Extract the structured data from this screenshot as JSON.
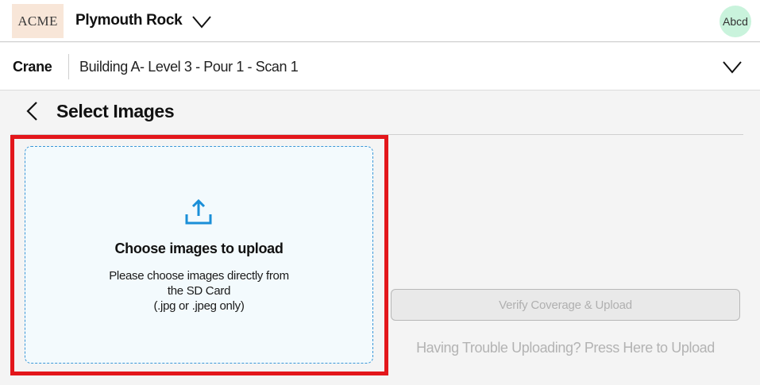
{
  "header": {
    "logo_text": "ACME",
    "project_name": "Plymouth Rock",
    "avatar_text": "Abcd"
  },
  "subheader": {
    "equipment": "Crane",
    "scan_path": "Building A- Level 3 - Pour 1 - Scan 1"
  },
  "page": {
    "title": "Select Images"
  },
  "dropzone": {
    "title": "Choose images to upload",
    "description_lines": [
      "Please choose images directly from",
      "the SD Card",
      "(.jpg or .jpeg only)"
    ]
  },
  "actions": {
    "verify_label": "Verify Coverage & Upload",
    "help_link": "Having Trouble Uploading? Press Here to Upload"
  },
  "icons": {
    "project_chevron": "chevron-down-icon",
    "scan_chevron": "chevron-down-icon",
    "back": "chevron-left-icon",
    "upload": "upload-icon"
  },
  "colors": {
    "accent_blue": "#1a8fd8",
    "highlight_red": "#e3161b",
    "logo_bg": "#f8e6d8",
    "avatar_bg": "#c9f3dc",
    "disabled_text": "#b0b0b0"
  }
}
